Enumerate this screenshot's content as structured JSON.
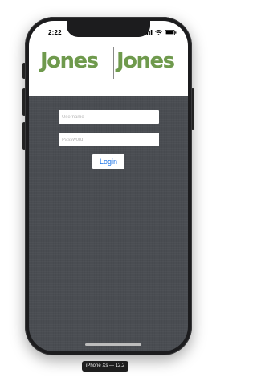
{
  "status_bar": {
    "time": "2:22",
    "icons": [
      "signal-icon",
      "wifi-icon",
      "battery-icon"
    ]
  },
  "logo": {
    "left_word": "Jones",
    "right_word": "Jones",
    "color": "#6f9a4d"
  },
  "form": {
    "username_placeholder": "Username",
    "password_placeholder": "Password",
    "username_value": "",
    "password_value": "",
    "login_label": "Login"
  },
  "simulator": {
    "device_label": "iPhone Xs — 12.2"
  },
  "colors": {
    "background": "#4a4d52",
    "login_text": "#1a73e8",
    "device_frame": "#1c1c1e"
  }
}
